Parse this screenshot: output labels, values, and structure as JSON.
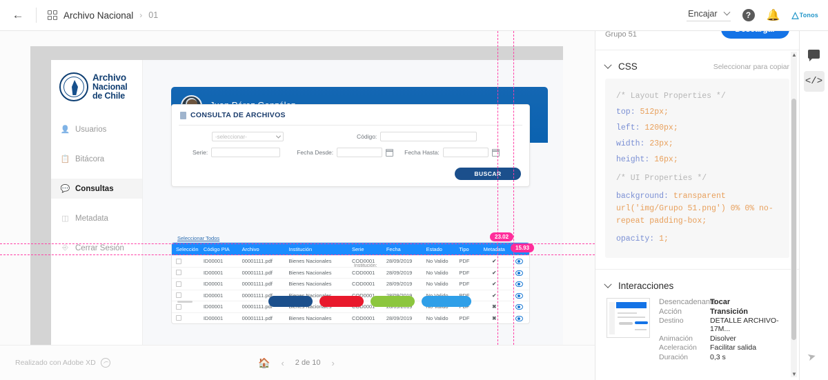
{
  "topbar": {
    "back_icon": "arrow-left-icon",
    "grid_icon": "grid-icon",
    "project_title": "Archivo Nacional",
    "separator": "›",
    "page_label": "01",
    "zoom_label": "Encajar",
    "help_icon": "?",
    "bell_icon": "🔔",
    "brand": "Tonos"
  },
  "app": {
    "sidebar": {
      "logo": {
        "line1": "Archivo",
        "line2": "Nacional",
        "line3": "de Chile"
      },
      "items": [
        {
          "label": "Usuarios",
          "icon": "users-icon",
          "active": false
        },
        {
          "label": "Bitácora",
          "icon": "clipboard-icon",
          "active": false
        },
        {
          "label": "Consultas",
          "icon": "chat-icon",
          "active": true
        },
        {
          "label": "Metadata",
          "icon": "box-icon",
          "active": false
        },
        {
          "label": "Cerrar Sesión",
          "icon": "logout-icon",
          "active": false
        }
      ]
    },
    "header": {
      "user_name": "Juan Pérez González",
      "avatar": "user-avatar"
    },
    "card": {
      "title": "CONSULTA DE ARCHIVOS",
      "select_value": "-seleccionar-",
      "fields": {
        "codigo_label": "Código:",
        "codigo_value": "",
        "serie_label": "Serie:",
        "serie_value": "",
        "fecha_desde_label": "Fecha Desde:",
        "fecha_desde_value": "",
        "fecha_hasta_label": "Fecha Hasta:",
        "fecha_hasta_value": ""
      },
      "search_button": "BUSCAR"
    },
    "table": {
      "select_all": "Seleccionar Todos",
      "overlay_label": "Institución:",
      "headers": [
        "Selección",
        "Código PIA",
        "Archivo",
        "Institución",
        "Serie",
        "Fecha",
        "Estado",
        "Tipo",
        "Metadata",
        ""
      ],
      "rows": [
        {
          "codigo": "ID00001",
          "archivo": "00001111.pdf",
          "institucion": "Bienes Nacionales",
          "serie": "COD0001",
          "fecha": "28/09/2019",
          "estado": "No Valido",
          "tipo": "PDF",
          "metadata": "ok"
        },
        {
          "codigo": "ID00001",
          "archivo": "00001111.pdf",
          "institucion": "Bienes Nacionales",
          "serie": "COD0001",
          "fecha": "28/09/2019",
          "estado": "No Valido",
          "tipo": "PDF",
          "metadata": "ok"
        },
        {
          "codigo": "ID00001",
          "archivo": "00001111.pdf",
          "institucion": "Bienes Nacionales",
          "serie": "COD0001",
          "fecha": "28/09/2019",
          "estado": "No Valido",
          "tipo": "PDF",
          "metadata": "ok"
        },
        {
          "codigo": "ID00001",
          "archivo": "00001111.pdf",
          "institucion": "Bienes Nacionales",
          "serie": "COD0001",
          "fecha": "28/09/2019",
          "estado": "No Valido",
          "tipo": "PDF",
          "metadata": "ok"
        },
        {
          "codigo": "ID00001",
          "archivo": "00001111.pdf",
          "institucion": "Bienes Nacionales",
          "serie": "COD0001",
          "fecha": "28/09/2019",
          "estado": "No Valido",
          "tipo": "PDF",
          "metadata": "no"
        },
        {
          "codigo": "ID00001",
          "archivo": "00001111.pdf",
          "institucion": "Bienes Nacionales",
          "serie": "COD0001",
          "fecha": "28/09/2019",
          "estado": "No Valido",
          "tipo": "PDF",
          "metadata": "no"
        }
      ]
    }
  },
  "measurements": {
    "badge_top": "23.02",
    "badge_bottom": "15.93"
  },
  "canvas_footer": {
    "credit": "Realizado con Adobe XD",
    "home_icon": "home-icon",
    "prev_icon": "‹",
    "page_count": "2 de 10",
    "next_icon": "›"
  },
  "panel": {
    "group_label": "Grupo 51",
    "download_button": "Descargar",
    "css": {
      "title": "CSS",
      "hint": "Seleccionar para copiar",
      "comment_layout": "/* Layout Properties */",
      "top_prop": "top:",
      "top_val": "512px;",
      "left_prop": "left:",
      "left_val": "1200px;",
      "width_prop": "width:",
      "width_val": "23px;",
      "height_prop": "height:",
      "height_val": "16px;",
      "comment_ui": "/* UI Properties */",
      "bg_prop": "background:",
      "bg_val": "transparent",
      "bg_val2": "url('img/Grupo 51.png') 0% 0% no-",
      "bg_val3": "repeat padding-box;",
      "opacity_prop": "opacity:",
      "opacity_val": "1;"
    },
    "interactions": {
      "title": "Interacciones",
      "rows": [
        {
          "key": "Desencadenante",
          "value": "Tocar",
          "bold": true
        },
        {
          "key": "Acción",
          "value": "Transición",
          "bold": true
        },
        {
          "key": "Destino",
          "value": "DETALLE ARCHIVO-17M...",
          "bold": false
        },
        {
          "key": "Animación",
          "value": "Disolver",
          "bold": false
        },
        {
          "key": "Aceleración",
          "value": "Facilitar salida",
          "bold": false
        },
        {
          "key": "Duración",
          "value": "0,3 s",
          "bold": false
        }
      ]
    }
  },
  "rail": {
    "comment_icon": "comment-icon",
    "code_icon": "code-icon"
  },
  "colors": {
    "accent_blue": "#1473e6",
    "table_header": "#1a8cff",
    "brand_navy": "#1b4f8c",
    "guide_pink": "#ff2d9b"
  }
}
